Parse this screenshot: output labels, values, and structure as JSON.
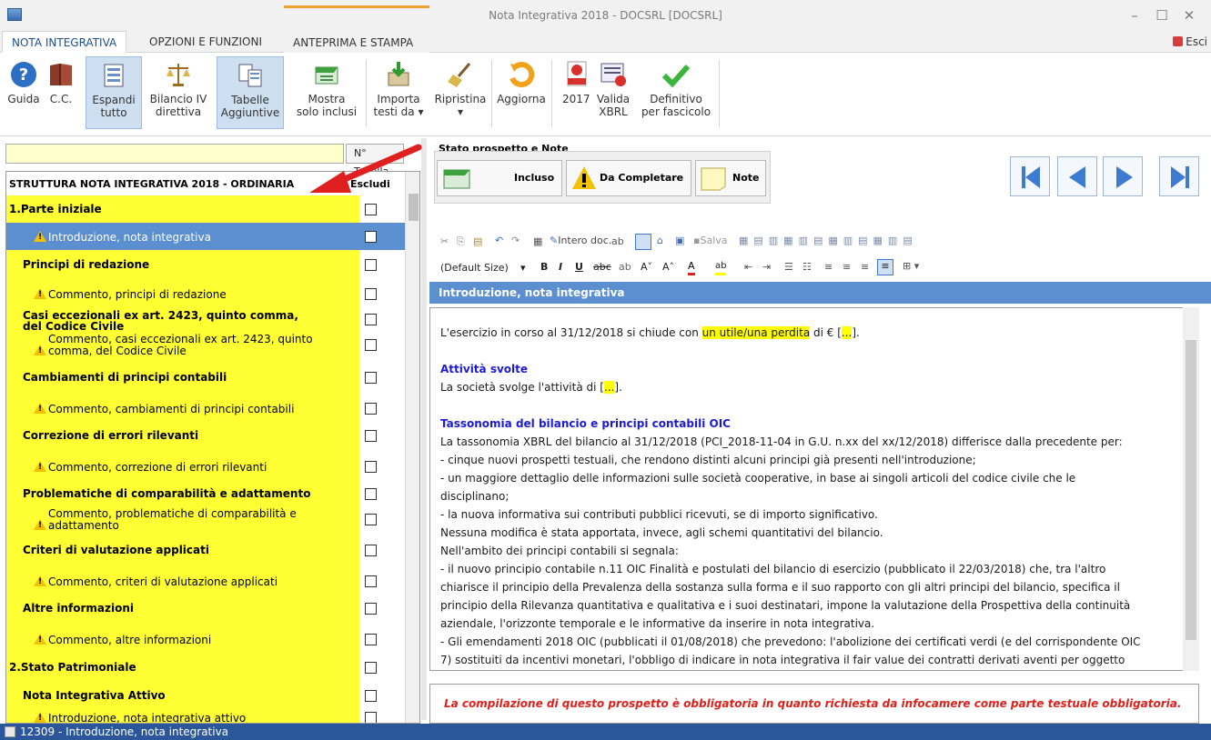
{
  "window": {
    "title": "Nota Integrativa 2018 - DOCSRL [DOCSRL]"
  },
  "tabs": [
    {
      "label": "NOTA INTEGRATIVA"
    },
    {
      "label": "OPZIONI E FUNZIONI"
    },
    {
      "label": "ANTEPRIMA E STAMPA"
    }
  ],
  "exit_label": "Esci",
  "ribbon": {
    "guida": "Guida",
    "cc": "C.C.",
    "espandi": [
      "Espandi",
      "tutto"
    ],
    "bilancio": [
      "Bilancio IV",
      "direttiva"
    ],
    "tabelle": [
      "Tabelle",
      "Aggiuntive"
    ],
    "mostra": [
      "Mostra",
      "solo inclusi"
    ],
    "importa": [
      "Importa",
      "testi da ▾"
    ],
    "ripristina": [
      "Ripristina",
      "▾"
    ],
    "aggiorna": "Aggiorna",
    "y2017": "2017",
    "valida": [
      "Valida",
      "XBRL"
    ],
    "definitivo": [
      "Definitivo",
      "per fascicolo"
    ]
  },
  "search": {
    "value": "",
    "button_label": "N° Tabella"
  },
  "tree": {
    "title": "STRUTTURA NOTA INTEGRATIVA 2018 - ORDINARIA",
    "exclude_header": "Escludi",
    "rows": [
      {
        "label": "1.Parte iniziale"
      },
      {
        "label": "Introduzione, nota integrativa"
      },
      {
        "label": "Principi di redazione"
      },
      {
        "label": "Commento, principi di redazione"
      },
      {
        "label": "Casi eccezionali ex art. 2423, quinto comma,",
        "label2": "del Codice Civile"
      },
      {
        "label": "Commento, casi eccezionali ex art. 2423, quinto",
        "label2": "comma, del Codice Civile"
      },
      {
        "label": "Cambiamenti di principi contabili"
      },
      {
        "label": "Commento, cambiamenti di principi contabili"
      },
      {
        "label": "Correzione di errori rilevanti"
      },
      {
        "label": "Commento, correzione di errori rilevanti"
      },
      {
        "label": "Problematiche di comparabilità e adattamento"
      },
      {
        "label": "Commento, problematiche di comparabilità e",
        "label2": "adattamento"
      },
      {
        "label": "Criteri di valutazione applicati"
      },
      {
        "label": "Commento, criteri di valutazione applicati"
      },
      {
        "label": "Altre informazioni"
      },
      {
        "label": "Commento, altre informazioni"
      },
      {
        "label": "2.Stato Patrimoniale"
      },
      {
        "label": "Nota Integrativa Attivo"
      },
      {
        "label": "Introduzione, nota integrativa attivo"
      }
    ]
  },
  "stato": {
    "title": "Stato prospetto e Note",
    "incluso": "Incluso",
    "da_completare": "Da Completare",
    "note": "Note"
  },
  "toolbar": {
    "intero_doc": "Intero doc.",
    "salva": "Salva",
    "size": "(Default Size)"
  },
  "section_title": "Introduzione, nota integrativa",
  "editor": {
    "p1_a": "L'esercizio in corso al 31/12/2018 si chiude con ",
    "p1_hl": "un utile/una perdita",
    "p1_b": " di € [",
    "p1_dots": "...",
    "p1_c": "].",
    "h1": "Attività svolte",
    "p2_a": "La società svolge l'attività di [",
    "p2_dots": "...",
    "p2_b": "].",
    "h2": "Tassonomia del bilancio e principi contabili OIC",
    "l1": "La tassonomia XBRL del bilancio al 31/12/2018 (PCI_2018-11-04 in G.U. n.xx del xx/12/2018) differisce dalla precedente per:",
    "l2": "- cinque nuovi prospetti testuali, che rendono distinti alcuni principi già presenti nell'introduzione;",
    "l3": "- un maggiore dettaglio delle informazioni sulle società cooperative, in base ai singoli articoli del codice civile che le",
    "l4": "disciplinano;",
    "l5": "- la nuova informativa sui contributi pubblici ricevuti, se di importo significativo.",
    "l6": "Nessuna modifica è stata apportata, invece, agli schemi quantitativi del bilancio.",
    "l7": "Nell'ambito dei principi contabili si segnala:",
    "l8": "- il nuovo principio contabile n.11 OIC Finalità e postulati del bilancio di esercizio (pubblicato il 22/03/2018) che, tra l'altro",
    "l9": "chiarisce il principio della Prevalenza della sostanza sulla forma e il suo rapporto con gli altri principi del bilancio, specifica il",
    "l10": "principio della Rilevanza quantitativa e qualitativa e i suoi destinatari, impone la valutazione della Prospettiva della continuità",
    "l11": "aziendale, l'orizzonte temporale e le informative da inserire in nota integrativa.",
    "l12": "- Gli emendamenti 2018 OIC (pubblicati il 01/08/2018) che prevedono: l'abolizione dei certificati verdi (e del corrispondente OIC",
    "l13": "7) sostituiti da incentivi monetari, l'obbligo di indicare in nota integrativa il fair value dei contratti derivati aventi per oggetto"
  },
  "note_text": "La compilazione di questo prospetto è obbligatoria in quanto richiesta da infocamere come parte testuale obbligatoria.",
  "status_bar": "12309 - Introduzione, nota integrativa"
}
